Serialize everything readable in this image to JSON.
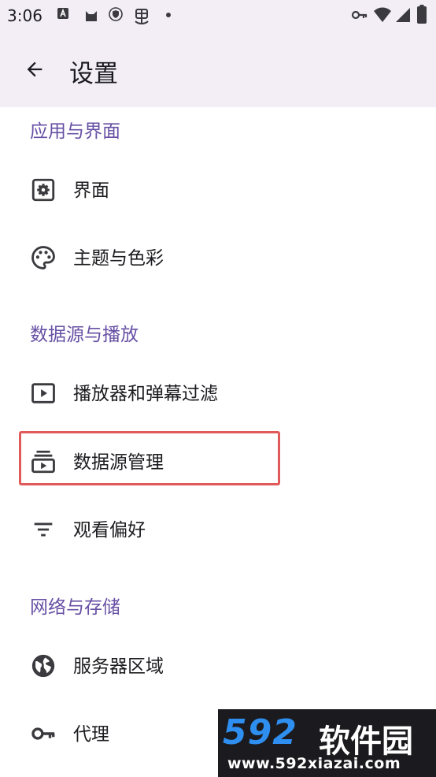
{
  "status_bar": {
    "time": "3:06",
    "icons": [
      "a-box-icon",
      "cat-icon",
      "shield-icon",
      "bug-icon",
      "dot-icon",
      "key-icon",
      "wifi-icon",
      "signal-icon",
      "battery-icon"
    ]
  },
  "app_bar": {
    "title": "设置"
  },
  "sections": [
    {
      "header": "应用与界面",
      "items": [
        {
          "label": "界面",
          "icon": "gear-box-icon"
        },
        {
          "label": "主题与色彩",
          "icon": "palette-icon"
        }
      ]
    },
    {
      "header": "数据源与播放",
      "items": [
        {
          "label": "播放器和弹幕过滤",
          "icon": "play-box-icon"
        },
        {
          "label": "数据源管理",
          "icon": "subscriptions-icon"
        },
        {
          "label": "观看偏好",
          "icon": "filter-list-icon"
        }
      ]
    },
    {
      "header": "网络与存储",
      "items": [
        {
          "label": "服务器区域",
          "icon": "globe-icon"
        },
        {
          "label": "代理",
          "icon": "key-icon"
        }
      ]
    }
  ],
  "watermark": {
    "brand_number": "592",
    "brand_text": "软件园",
    "url": "www.592xiazai.com"
  },
  "colors": {
    "accent": "#6750a4",
    "appbar_bg": "#f3eef6",
    "highlight": "#e05a5a"
  }
}
